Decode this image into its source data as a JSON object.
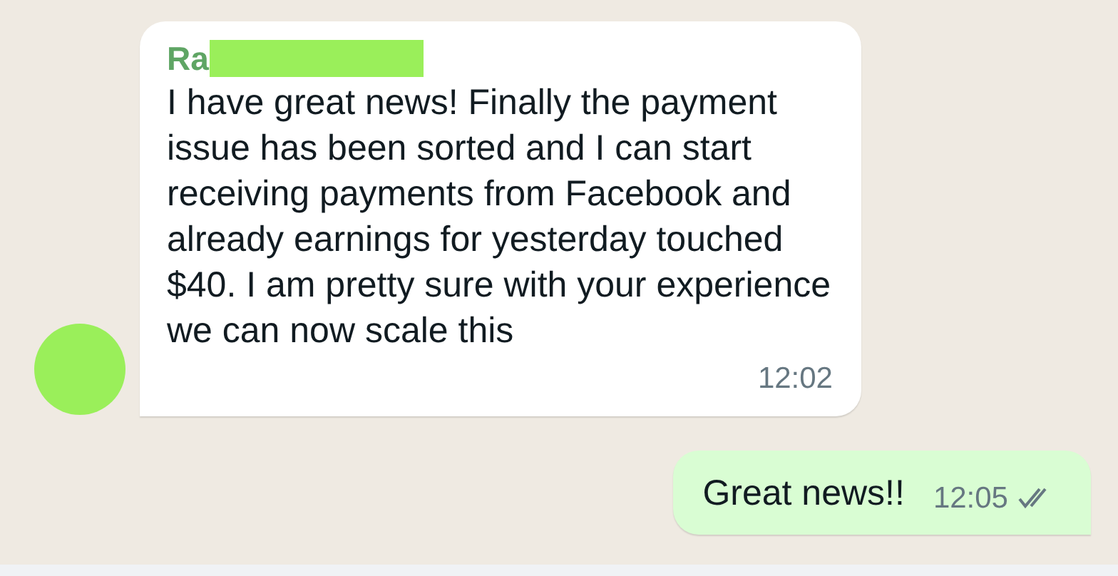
{
  "incoming": {
    "sender": "Ra",
    "text": "I have great news! Finally the payment issue has been sorted and I can start receiving payments from Facebook and already earnings for yesterday touched $40. I am pretty sure with your experience we can now scale this",
    "time": "12:02"
  },
  "outgoing": {
    "text": "Great news!!",
    "time": "12:05",
    "read": true
  }
}
